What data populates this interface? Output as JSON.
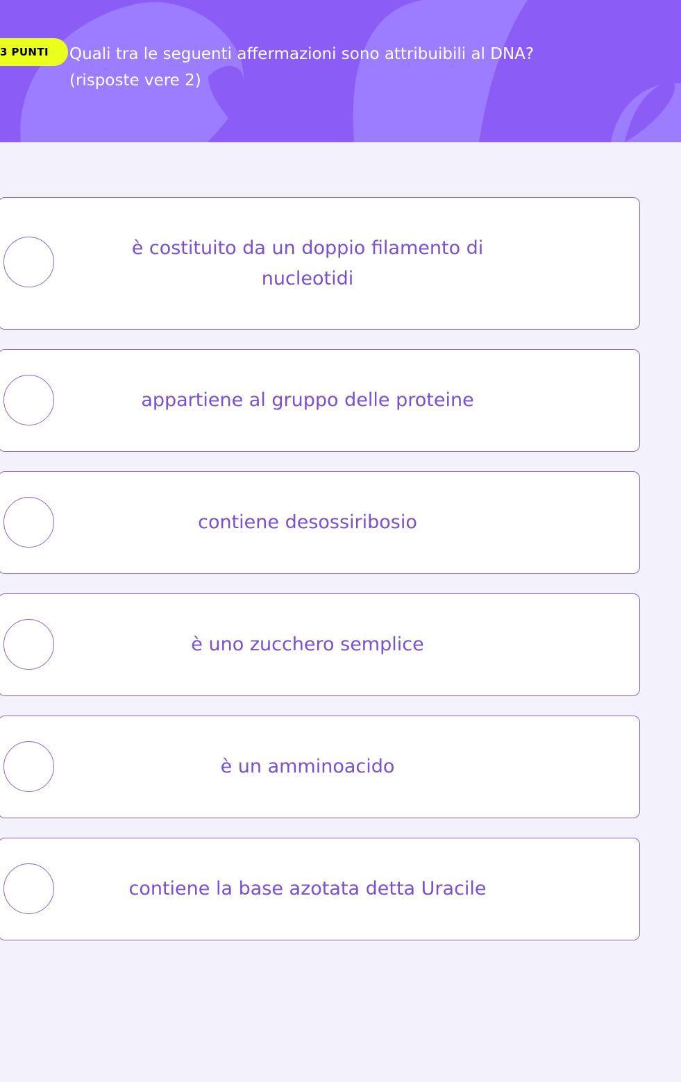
{
  "question": {
    "points_label": "3 PUNTI",
    "title": "Quali tra le seguenti affermazioni sono attribuibili al DNA?",
    "subtitle": "(risposte vere 2)"
  },
  "options": [
    {
      "label": "è costituito da un doppio filamento di nucleotidi"
    },
    {
      "label": "appartiene al gruppo delle proteine"
    },
    {
      "label": "contiene desossiribosio"
    },
    {
      "label": "è uno zucchero semplice"
    },
    {
      "label": "è un amminoacido"
    },
    {
      "label": "contiene la base azotata detta Uracile"
    }
  ],
  "colors": {
    "header": "#8b5cf6",
    "badge": "#eaff1a",
    "option_border": "#8e63c9",
    "option_text": "#7a4fd0",
    "page_bg": "#f3f2fa"
  }
}
